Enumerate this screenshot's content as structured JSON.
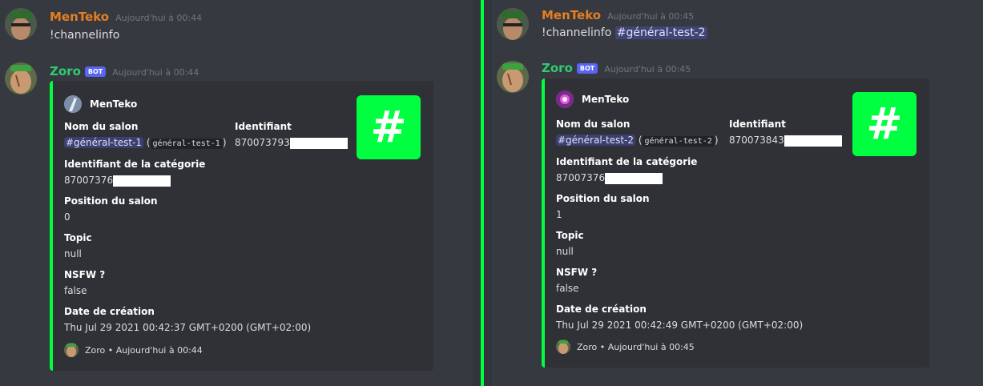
{
  "left": {
    "user_message": {
      "username": "MenTeko",
      "timestamp": "Aujourd'hui à 00:44",
      "command": "!channelinfo"
    },
    "bot_message": {
      "username": "Zoro",
      "bot_tag": "BOT",
      "timestamp": "Aujourd'hui à 00:44",
      "embed": {
        "author": "MenTeko",
        "thumbnail_glyph": "#",
        "fields": {
          "channel_name": {
            "name": "Nom du salon",
            "mention": "#général-test-1",
            "code": "général-test-1"
          },
          "id": {
            "name": "Identifiant",
            "value": "870073793"
          },
          "category_id": {
            "name": "Identifiant de la catégorie",
            "value": "87007376"
          },
          "position": {
            "name": "Position du salon",
            "value": "0"
          },
          "topic": {
            "name": "Topic",
            "value": "null"
          },
          "nsfw": {
            "name": "NSFW ?",
            "value": "false"
          },
          "created": {
            "name": "Date de création",
            "value": "Thu Jul 29 2021 00:42:37 GMT+0200 (GMT+02:00)"
          }
        },
        "footer": "Zoro • Aujourd'hui à 00:44"
      }
    }
  },
  "right": {
    "user_message": {
      "username": "MenTeko",
      "timestamp": "Aujourd'hui à 00:45",
      "command": "!channelinfo",
      "mention": "#général-test-2"
    },
    "bot_message": {
      "username": "Zoro",
      "bot_tag": "BOT",
      "timestamp": "Aujourd'hui à 00:45",
      "embed": {
        "author": "MenTeko",
        "thumbnail_glyph": "#",
        "fields": {
          "channel_name": {
            "name": "Nom du salon",
            "mention": "#général-test-2",
            "code": "général-test-2"
          },
          "id": {
            "name": "Identifiant",
            "value": "870073843"
          },
          "category_id": {
            "name": "Identifiant de la catégorie",
            "value": "87007376"
          },
          "position": {
            "name": "Position du salon",
            "value": "1"
          },
          "topic": {
            "name": "Topic",
            "value": "null"
          },
          "nsfw": {
            "name": "NSFW ?",
            "value": "false"
          },
          "created": {
            "name": "Date de création",
            "value": "Thu Jul 29 2021 00:42:49 GMT+0200 (GMT+02:00)"
          }
        },
        "footer": "Zoro • Aujourd'hui à 00:45"
      }
    }
  },
  "colors": {
    "background": "#36393f",
    "embed_bg": "#2f3136",
    "accent_green": "#00ff40",
    "username_user": "#e67e22",
    "username_bot": "#2ecc71",
    "bot_tag": "#5865f2"
  }
}
